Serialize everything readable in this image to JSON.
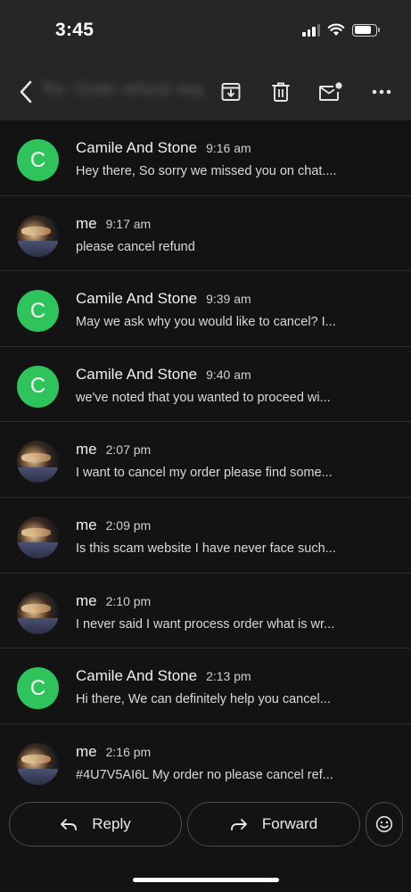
{
  "status_bar": {
    "time": "3:45"
  },
  "header": {
    "subject": "Re: Order refund request"
  },
  "messages": [
    {
      "sender": "Camile And Stone",
      "time": "9:16 am",
      "snippet": "Hey there, So sorry we missed you on chat....",
      "avatar_type": "letter",
      "avatar_letter": "C"
    },
    {
      "sender": "me",
      "time": "9:17 am",
      "snippet": "please cancel refund",
      "avatar_type": "photo"
    },
    {
      "sender": "Camile And Stone",
      "time": "9:39 am",
      "snippet": "May we ask why you would like to cancel? I...",
      "avatar_type": "letter",
      "avatar_letter": "C"
    },
    {
      "sender": "Camile And Stone",
      "time": "9:40 am",
      "snippet": "we've noted that you wanted to proceed wi...",
      "avatar_type": "letter",
      "avatar_letter": "C"
    },
    {
      "sender": "me",
      "time": "2:07 pm",
      "snippet": "I want to cancel my order please find some...",
      "avatar_type": "photo"
    },
    {
      "sender": "me",
      "time": "2:09 pm",
      "snippet": "Is this scam website I have never face such...",
      "avatar_type": "photo"
    },
    {
      "sender": "me",
      "time": "2:10 pm",
      "snippet": "I never said I want process order what is wr...",
      "avatar_type": "photo"
    },
    {
      "sender": "Camile And Stone",
      "time": "2:13 pm",
      "snippet": "Hi there, We can definitely help you cancel...",
      "avatar_type": "letter",
      "avatar_letter": "C"
    },
    {
      "sender": "me",
      "time": "2:16 pm",
      "snippet": "#4U7V5AI6L My order no please cancel ref...",
      "avatar_type": "photo"
    }
  ],
  "actions": {
    "reply_label": "Reply",
    "forward_label": "Forward"
  },
  "colors": {
    "avatar_green": "#2ec45b",
    "background": "#131313",
    "bar": "#262626"
  }
}
